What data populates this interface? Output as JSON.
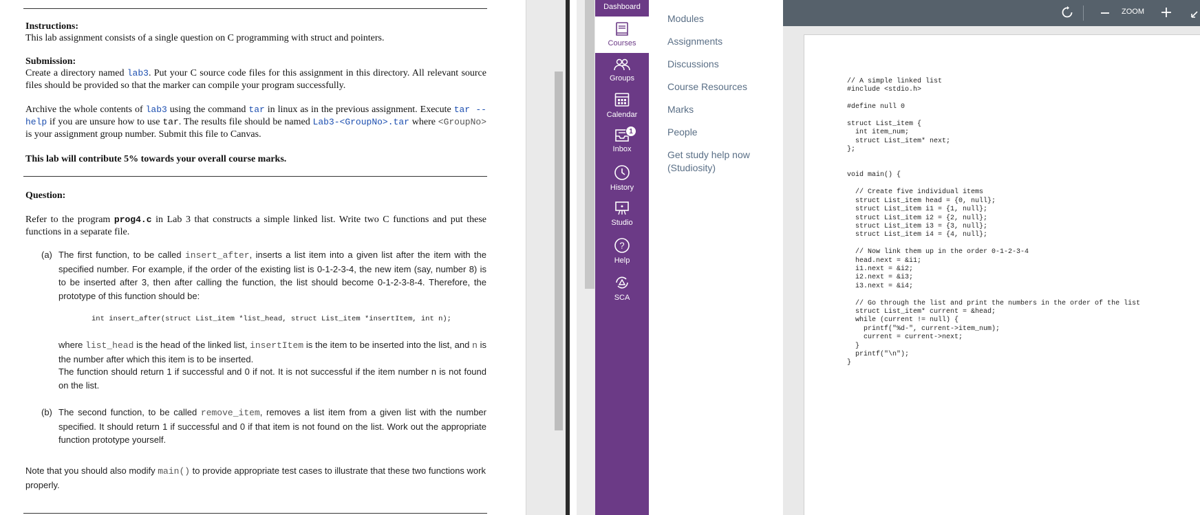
{
  "doc": {
    "instructions_heading": "Instructions:",
    "instructions_text": "This lab assignment consists of a single question on C programming with struct and pointers.",
    "submission_heading": "Submission:",
    "sub_p1": [
      "Create a directory named ",
      "lab3",
      ". Put your C source code files for this assignment in this directory. All relevant source files should be provided so that the marker can compile your program successfully."
    ],
    "sub_p2": [
      "Archive the whole contents of ",
      "lab3",
      " using the command ",
      "tar",
      " in linux as in the previous assignment. Execute ",
      "tar --help",
      " if you are unsure how to use ",
      "tar",
      ". The results file should be named ",
      "Lab3-<GroupNo>.tar",
      " where ",
      "<GroupNo>",
      " is your assignment group number. Submit this file to Canvas."
    ],
    "contribution": "This lab will contribute 5% towards your overall course marks.",
    "question_heading": "Question:",
    "q_intro": [
      "Refer to the program ",
      "prog4.c",
      " in Lab 3 that constructs a simple linked list. Write two C functions and put these functions in a separate file."
    ],
    "a_label": "(a)",
    "a_p1": [
      "The first function, to be called ",
      "insert_after",
      ", inserts a list item into a given list after the item with the specified number. For example, if the order of the existing list is 0-1-2-3-4, the new item (say, number 8) is to be inserted after 3, then after calling the function, the list should become 0-1-2-3-8-4. Therefore, the prototype of this function should be:"
    ],
    "a_proto": "int insert_after(struct List_item *list_head, struct List_item *insertItem, int n);",
    "a_p2": [
      "where ",
      "list_head",
      " is the head of the linked list, ",
      "insertItem",
      " is the item to be inserted into the list, and ",
      "n",
      " is the number after which this item is to be inserted."
    ],
    "a_p3": "The function should return 1 if successful and 0 if not. It is not successful if the item number n is not found on the list.",
    "b_label": "(b)",
    "b_p1": [
      "The second function, to be called ",
      "remove_item",
      ", removes a list item from a given list with the number specified. It should return 1 if successful and 0 if that item is not found on the list. Work out the appropriate function prototype yourself."
    ],
    "note": [
      "Note that you should also modify ",
      "main()",
      " to provide appropriate test cases to illustrate that these two functions work properly."
    ]
  },
  "nav": {
    "dashboard": "Dashboard",
    "courses": "Courses",
    "groups": "Groups",
    "calendar": "Calendar",
    "inbox": "Inbox",
    "inbox_badge": "1",
    "history": "History",
    "studio": "Studio",
    "help": "Help",
    "sca": "SCA",
    "active_color": "#6b3a86"
  },
  "menu": {
    "items": [
      "Modules",
      "Assignments",
      "Discussions",
      "Course Resources",
      "Marks",
      "People",
      "Get study help now",
      "(Studiosity)"
    ]
  },
  "viewer": {
    "zoom_label": "ZOOM",
    "code": "// A simple linked list\n#include <stdio.h>\n\n#define null 0\n\nstruct List_item {\n  int item_num;\n  struct List_item* next;\n};\n\n\nvoid main() {\n\n  // Create five individual items\n  struct List_item head = {0, null};\n  struct List_item i1 = {1, null};\n  struct List_item i2 = {2, null};\n  struct List_item i3 = {3, null};\n  struct List_item i4 = {4, null};\n\n  // Now link them up in the order 0-1-2-3-4\n  head.next = &i1;\n  i1.next = &i2;\n  i2.next = &i3;\n  i3.next = &i4;\n\n  // Go through the list and print the numbers in the order of the list\n  struct List_item* current = &head;\n  while (current != null) {\n    printf(\"%d-\", current->item_num);\n    current = current->next;\n  }\n  printf(\"\\n\");\n}"
  }
}
